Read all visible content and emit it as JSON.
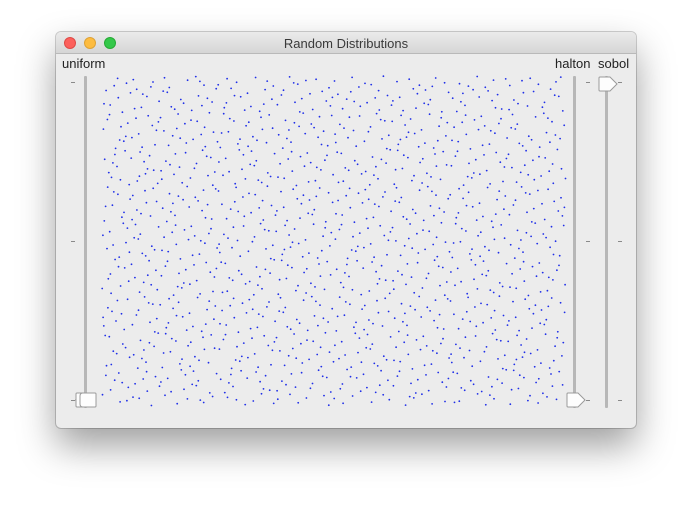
{
  "window": {
    "title": "Random Distributions"
  },
  "labels": {
    "left": "uniform",
    "right_a": "halton",
    "right_b": "sobol"
  },
  "sliders": {
    "uniform": {
      "level": 0.0
    },
    "halton": {
      "level": 0.0
    },
    "sobol": {
      "level": 1.0
    }
  },
  "plot": {
    "point_color": "#1f2fe8",
    "point_count": 1300
  },
  "colors": {
    "window_bg": "#ececec",
    "close": "#fc605c",
    "minimize": "#fdbc40",
    "maximize": "#34c84a"
  }
}
